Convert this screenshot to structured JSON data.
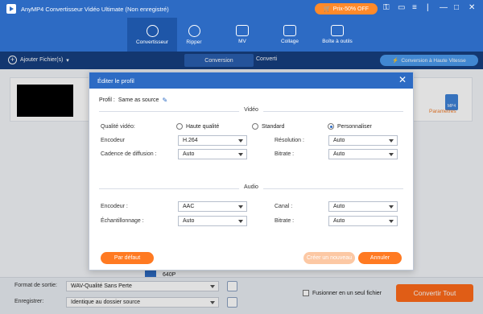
{
  "window": {
    "title": "AnyMP4 Convertisseur Vidéo Ultimate (Non enregistré)",
    "promo": "Prix-50% OFF"
  },
  "nav": {
    "items": [
      {
        "label": "Convertisseur",
        "icon": "convert-icon"
      },
      {
        "label": "Ripper",
        "icon": "disc-icon"
      },
      {
        "label": "MV",
        "icon": "tv-icon"
      },
      {
        "label": "Collage",
        "icon": "collage-icon"
      },
      {
        "label": "Boîte à outils",
        "icon": "toolbox-icon"
      }
    ]
  },
  "subbar": {
    "add_files": "Ajouter Fichier(s)",
    "tab_conversion": "Conversion",
    "tab_converted": "Converti",
    "high_speed": "Conversion à Haute Vitesse"
  },
  "file": {
    "format_badge": "MP4",
    "params_label": "Paramètres",
    "resolution": "640P"
  },
  "bottom": {
    "output_format_label": "Format de sortie:",
    "output_format_value": "WAV-Qualité Sans Perte",
    "save_label": "Enregistrer:",
    "save_value": "Identique au dossier source",
    "merge_label": "Fusionner en un seul fichier",
    "convert_all": "Convertir Tout"
  },
  "dialog": {
    "title": "Éditer le profil",
    "profile_label": "Profil :",
    "profile_value": "Same as source",
    "video_section": "Vidéo",
    "audio_section": "Audio",
    "video_quality_label": "Qualité vidéo:",
    "quality_options": [
      "Haute qualité",
      "Standard",
      "Personnaliser"
    ],
    "quality_selected": "Personnaliser",
    "video_encoder_label": "Encodeur",
    "video_encoder_value": "H.264",
    "resolution_label": "Résolution :",
    "resolution_value": "Auto",
    "framerate_label": "Cadence de diffusion :",
    "framerate_value": "Auto",
    "video_bitrate_label": "Bitrate :",
    "video_bitrate_value": "Auto",
    "audio_encoder_label": "Encodeur :",
    "audio_encoder_value": "AAC",
    "channel_label": "Canal :",
    "channel_value": "Auto",
    "samplerate_label": "Échantillonnage :",
    "samplerate_value": "Auto",
    "audio_bitrate_label": "Bitrate :",
    "audio_bitrate_value": "Auto",
    "default_button": "Par défaut",
    "create_new_button": "Créer un nouveau",
    "cancel_button": "Annuler"
  }
}
